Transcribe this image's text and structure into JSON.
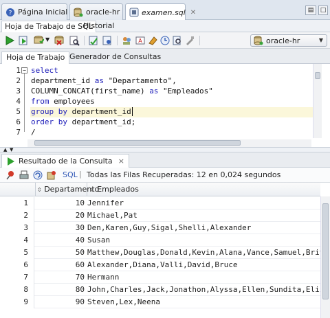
{
  "doc_tabs": [
    {
      "label": "Página Inicial",
      "icon": "help-icon"
    },
    {
      "label": "oracle-hr",
      "icon": "database-icon"
    },
    {
      "label": "examen.sql",
      "icon": "sql-file-icon"
    }
  ],
  "sub_tabs": [
    "Hoja de Trabajo de SQL",
    "Historial"
  ],
  "connection": {
    "label": "oracle-hr",
    "icon": "database-icon"
  },
  "worksheet_tabs": [
    "Hoja de Trabajo",
    "Generador de Consultas"
  ],
  "editor": {
    "line_numbers": [
      "1",
      "2",
      "3",
      "4",
      "5",
      "6",
      "7"
    ],
    "fold_sign": "−"
  },
  "results": {
    "tab_label": "Resultado de la Consulta",
    "tab_close": "×",
    "sql_label": "SQL",
    "separator": "|",
    "status": "Todas las Filas Recuperadas: 12 en 0,024 segundos",
    "columns": [
      "Departamento",
      "Empleados"
    ],
    "rows": [
      {
        "n": "1",
        "dep": "10",
        "emp": "Jennifer"
      },
      {
        "n": "2",
        "dep": "20",
        "emp": "Michael,Pat"
      },
      {
        "n": "3",
        "dep": "30",
        "emp": "Den,Karen,Guy,Sigal,Shelli,Alexander"
      },
      {
        "n": "4",
        "dep": "40",
        "emp": "Susan"
      },
      {
        "n": "5",
        "dep": "50",
        "emp": "Matthew,Douglas,Donald,Kevin,Alana,Vance,Samuel,Britne"
      },
      {
        "n": "6",
        "dep": "60",
        "emp": "Alexander,Diana,Valli,David,Bruce"
      },
      {
        "n": "7",
        "dep": "70",
        "emp": "Hermann"
      },
      {
        "n": "8",
        "dep": "80",
        "emp": "John,Charles,Jack,Jonathon,Alyssa,Ellen,Sundita,Elizab"
      },
      {
        "n": "9",
        "dep": "90",
        "emp": "Steven,Lex,Neena"
      }
    ]
  },
  "colors": {
    "keyword": "#1a1ab8",
    "current_line": "#fbf7da",
    "run_green": "#2ea12e"
  }
}
